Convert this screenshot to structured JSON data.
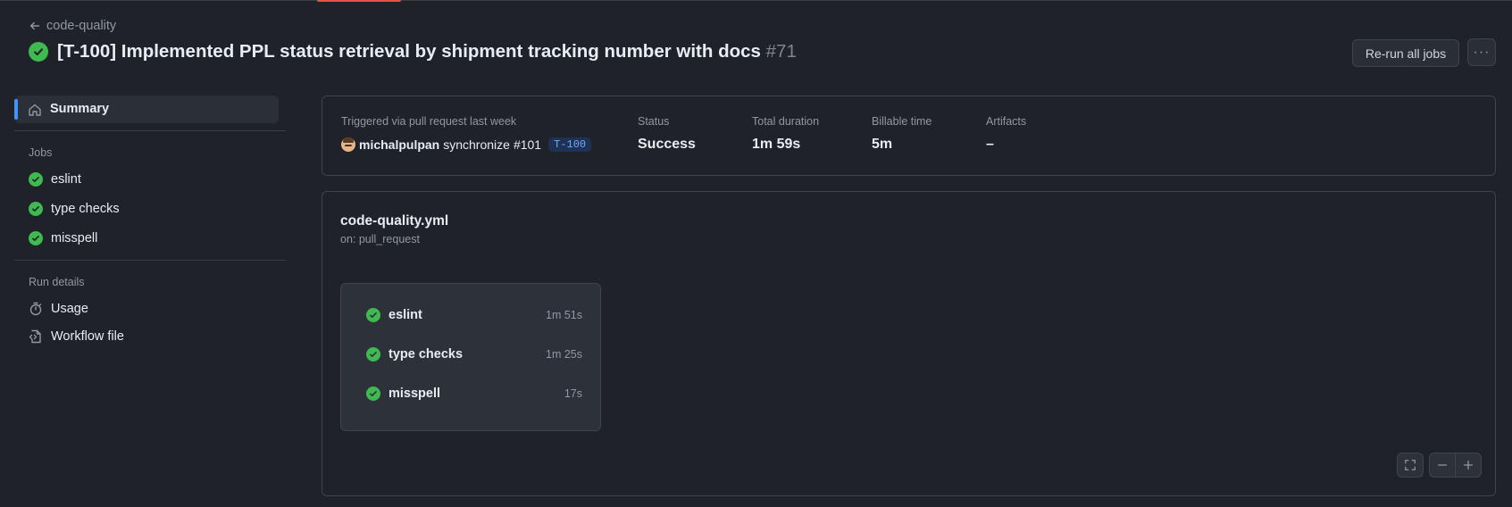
{
  "header": {
    "back_label": "code-quality",
    "title": "[T-100] Implemented PPL status retrieval by shipment tracking number with docs",
    "run_number": "#71",
    "rerun_label": "Re-run all jobs",
    "more_label": "···"
  },
  "sidebar": {
    "summary_label": "Summary",
    "jobs_heading": "Jobs",
    "jobs": [
      {
        "label": "eslint"
      },
      {
        "label": "type checks"
      },
      {
        "label": "misspell"
      }
    ],
    "run_details_heading": "Run details",
    "usage_label": "Usage",
    "workflow_file_label": "Workflow file"
  },
  "summary": {
    "trigger_label": "Triggered via pull request last week",
    "user": "michalpulpan",
    "action": "synchronize",
    "pr": "#101",
    "branch": "T-100",
    "status_label": "Status",
    "status_value": "Success",
    "duration_label": "Total duration",
    "duration_value": "1m 59s",
    "billable_label": "Billable time",
    "billable_value": "5m",
    "artifacts_label": "Artifacts",
    "artifacts_value": "–"
  },
  "workflow": {
    "file": "code-quality.yml",
    "on": "on: pull_request",
    "jobs": [
      {
        "name": "eslint",
        "duration": "1m 51s"
      },
      {
        "name": "type checks",
        "duration": "1m 25s"
      },
      {
        "name": "misspell",
        "duration": "17s"
      }
    ]
  },
  "colors": {
    "background": "#1f2228",
    "success": "#3fb950",
    "accent": "#4493f8",
    "branch_tag_bg": "#1f3254",
    "branch_tag_text": "#74a6ff"
  },
  "icons": {
    "back": "arrow-left-icon",
    "status": "check-circle-icon",
    "summary": "home-icon",
    "usage": "stopwatch-icon",
    "workflow_file": "file-code-icon",
    "fullscreen": "fullscreen-icon",
    "zoom_out": "minus-icon",
    "zoom_in": "plus-icon"
  }
}
